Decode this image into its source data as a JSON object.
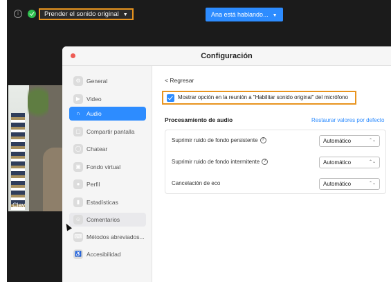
{
  "topbar": {
    "original_sound_label": "Prender el sonido original",
    "original_sound_caret": "▼",
    "speaking_label": "Ana está hablando...",
    "speaking_caret": "▼",
    "info_icon": "i"
  },
  "video": {
    "participant_name": "Clay"
  },
  "settings": {
    "title": "Configuración",
    "sidebar": [
      {
        "label": "General",
        "icon": "gear-icon",
        "glyph": "⚙"
      },
      {
        "label": "Video",
        "icon": "video-icon",
        "glyph": "▶"
      },
      {
        "label": "Audio",
        "icon": "headphones-icon",
        "glyph": "∩"
      },
      {
        "label": "Compartir pantalla",
        "icon": "share-screen-icon",
        "glyph": "▢"
      },
      {
        "label": "Chatear",
        "icon": "chat-icon",
        "glyph": "◯"
      },
      {
        "label": "Fondo virtual",
        "icon": "background-icon",
        "glyph": "▣"
      },
      {
        "label": "Perfil",
        "icon": "profile-icon",
        "glyph": "●"
      },
      {
        "label": "Estadísticas",
        "icon": "stats-icon",
        "glyph": "▮"
      },
      {
        "label": "Comentarios",
        "icon": "feedback-icon",
        "glyph": "☺"
      },
      {
        "label": "Métodos abreviados...",
        "icon": "keyboard-icon",
        "glyph": "⌨"
      },
      {
        "label": "Accesibilidad",
        "icon": "accessibility-icon",
        "glyph": "♿"
      }
    ],
    "active_item": "Audio",
    "back_label": "< Regresar",
    "checkbox_label": "Mostrar opción en la reunión a \"Habilitar sonido original\" del micrófono",
    "checkbox_checked": true,
    "section_title": "Procesamiento de audio",
    "restore_defaults": "Restaurar valores por defecto",
    "rows": [
      {
        "label": "Suprimir ruido de fondo persistente",
        "value": "Automático",
        "help": "?"
      },
      {
        "label": "Suprimir ruido de fondo intermitente",
        "value": "Automático",
        "help": "?"
      },
      {
        "label": "Cancelación de eco",
        "value": "Automático"
      }
    ],
    "select_chevron": "⌃⌄"
  },
  "colors": {
    "accent": "#2d8cff",
    "highlight": "#e8941f",
    "close": "#ee5c55",
    "shield": "#2fbf4f"
  }
}
